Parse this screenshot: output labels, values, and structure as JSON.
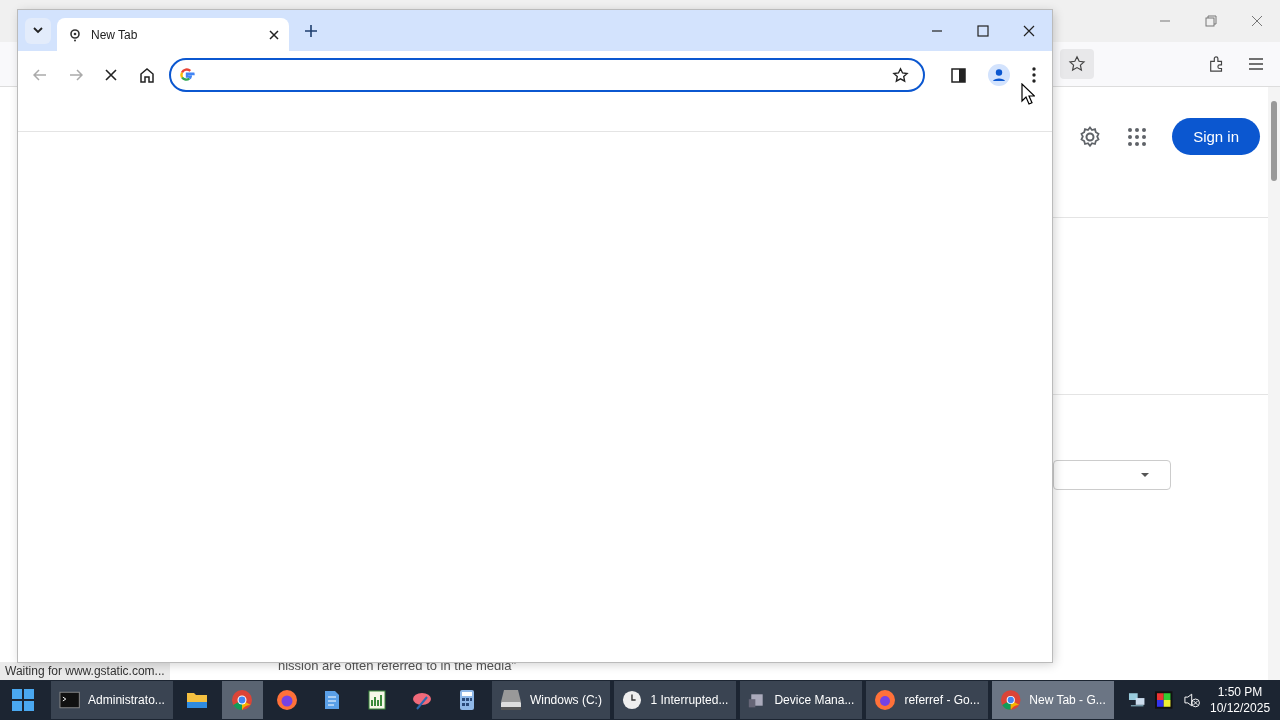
{
  "background_window": {
    "sign_in_button": "Sign in",
    "page_text": "nission are often referred to in the media\"",
    "status_text": "Waiting for www.gstatic.com..."
  },
  "browser_window": {
    "tabs": [
      {
        "label": "New Tab",
        "selected": true
      }
    ],
    "address_bar": {
      "loading": true
    }
  },
  "taskbar": {
    "items": [
      {
        "kind": "start",
        "selected": false
      },
      {
        "kind": "window",
        "label": "Administrato...",
        "selected": false
      },
      {
        "kind": "pinned",
        "selected": false
      },
      {
        "kind": "pinned",
        "selected": true
      },
      {
        "kind": "pinned",
        "selected": false
      },
      {
        "kind": "pinned",
        "selected": false
      },
      {
        "kind": "pinned",
        "selected": false
      },
      {
        "kind": "pinned",
        "selected": false
      },
      {
        "kind": "pinned",
        "selected": false
      },
      {
        "kind": "window",
        "label": "Windows (C:)",
        "selected": false
      },
      {
        "kind": "window",
        "label": "1 Interrupted...",
        "selected": false
      },
      {
        "kind": "window",
        "label": "Device Mana...",
        "selected": false
      },
      {
        "kind": "window",
        "label": "referref - Go...",
        "selected": false
      },
      {
        "kind": "window",
        "label": "New Tab - G...",
        "selected": true
      }
    ],
    "clock": {
      "time": "1:50 PM",
      "date": "10/12/2025"
    }
  }
}
